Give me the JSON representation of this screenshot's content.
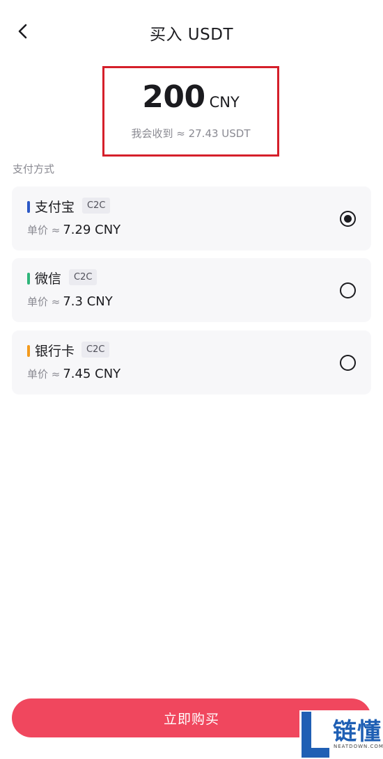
{
  "header": {
    "title": "买入 USDT",
    "back_icon": "chevron-left-icon"
  },
  "amount": {
    "value": "200",
    "currency": "CNY",
    "receive_text": "我会收到 ≈ 27.43 USDT"
  },
  "section_label": "支付方式",
  "payment_methods": [
    {
      "name": "支付宝",
      "tag": "C2C",
      "price_prefix": "单价 ≈",
      "price": "7.29 CNY",
      "accent": "#2b58c6",
      "selected": true
    },
    {
      "name": "微信",
      "tag": "C2C",
      "price_prefix": "单价 ≈",
      "price": "7.3 CNY",
      "accent": "#2fb57a",
      "selected": false
    },
    {
      "name": "银行卡",
      "tag": "C2C",
      "price_prefix": "单价 ≈",
      "price": "7.45 CNY",
      "accent": "#f39a1d",
      "selected": false
    }
  ],
  "buy_button": {
    "label": "立即购买",
    "color": "#f0475e"
  },
  "watermark": {
    "text": "链懂",
    "sub": "NEATDOWN.COM"
  },
  "colors": {
    "highlight_border": "#d51f2a"
  }
}
